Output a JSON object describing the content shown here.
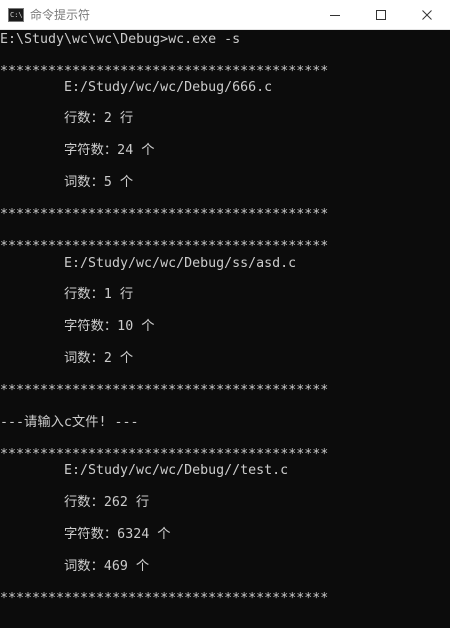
{
  "window": {
    "title": "命令提示符",
    "icon": "cmd-icon",
    "icon_glyph": "C:\\",
    "controls": [
      "minimize-icon",
      "maximize-icon",
      "close-icon"
    ]
  },
  "console": {
    "prompt": "E:\\Study\\wc\\wc\\Debug>wc.exe -s",
    "separator": "*****************************************",
    "blocks": [
      {
        "path": "E:/Study/wc/wc/Debug/666.c",
        "lines": "行数：2 行",
        "chars": "字符数：24 个",
        "words": "词数：5 个"
      },
      {
        "path": "E:/Study/wc/wc/Debug/ss/asd.c",
        "lines": "行数：1 行",
        "chars": "字符数：10 个",
        "words": "词数：2 个"
      },
      {
        "path": "E:/Study/wc/wc/Debug//test.c",
        "lines": "行数：262 行",
        "chars": "字符数：6324 个",
        "words": "词数：469 个"
      }
    ],
    "notice": "---请输入c文件! ---"
  },
  "colors": {
    "console_bg": "#0c0c0c",
    "console_text": "#cccccc",
    "titlebar_bg": "#ffffff",
    "titlebar_text": "#7a7a7a"
  }
}
